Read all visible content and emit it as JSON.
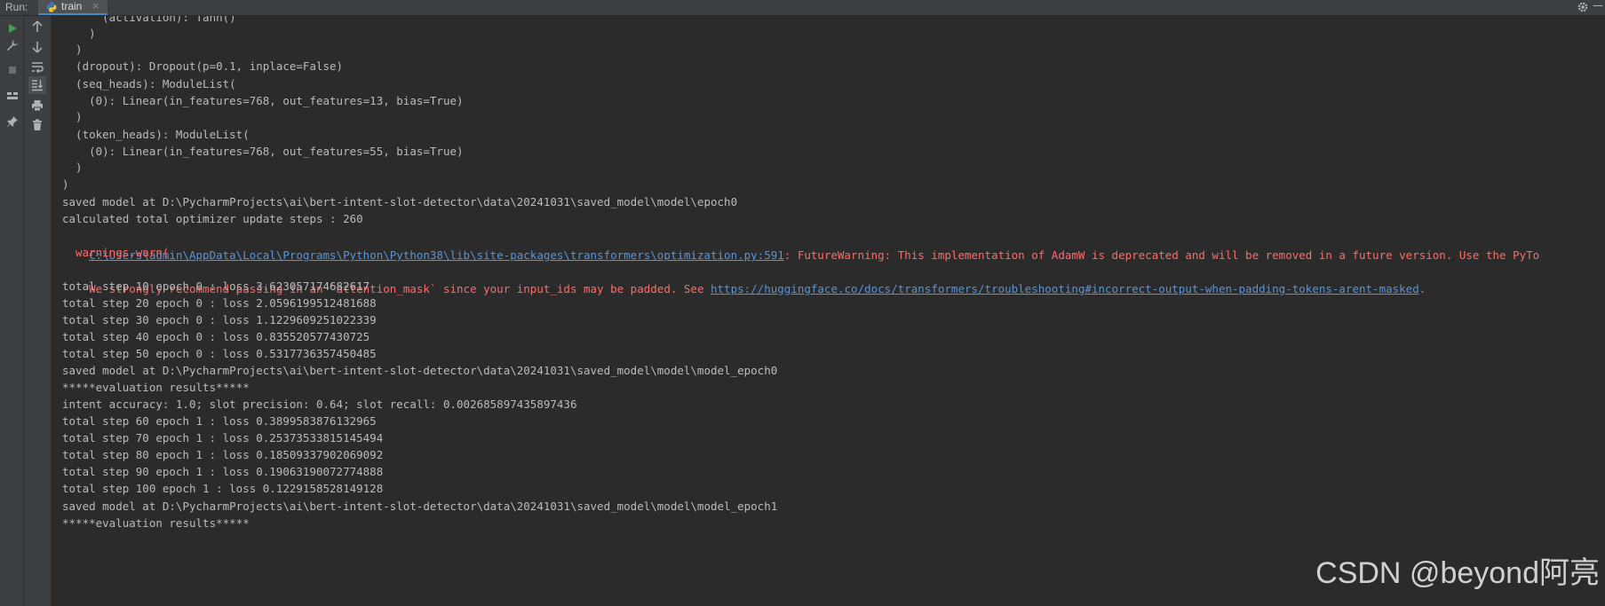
{
  "titlebar": {
    "run_label": "Run:",
    "tab_title": "train",
    "tab_icon": "python-icon",
    "close_glyph": "×",
    "settings_icon": "gear-icon",
    "minimize_glyph": "—"
  },
  "left_toolbar": [
    {
      "name": "rerun-icon",
      "color": "#499c54"
    },
    {
      "name": "wrench-icon",
      "color": "#afb1b3"
    },
    {
      "name": "stop-icon",
      "color": "#6e6e6e"
    },
    {
      "name": "layout-icon",
      "color": "#afb1b3"
    },
    {
      "name": "pin-icon",
      "color": "#afb1b3"
    }
  ],
  "console_toolbar": [
    {
      "name": "arrow-up-icon"
    },
    {
      "name": "arrow-down-icon"
    },
    {
      "name": "soft-wrap-icon"
    },
    {
      "name": "scroll-to-end-icon"
    },
    {
      "name": "print-icon"
    },
    {
      "name": "trash-icon"
    }
  ],
  "colors": {
    "background": "#2b2b2b",
    "toolbar": "#3c3f41",
    "text": "#bbbbbb",
    "error": "#ff6b68",
    "link": "#5894d9",
    "accent": "#4a88c7"
  },
  "console": {
    "lines": [
      "      (activation): Tanh()",
      "    )",
      "  )",
      "  (dropout): Dropout(p=0.1, inplace=False)",
      "  (seq_heads): ModuleList(",
      "    (0): Linear(in_features=768, out_features=13, bias=True)",
      "  )",
      "  (token_heads): ModuleList(",
      "    (0): Linear(in_features=768, out_features=55, bias=True)",
      "  )",
      ")",
      "saved model at D:\\PycharmProjects\\ai\\bert-intent-slot-detector\\data\\20241031\\saved_model\\model\\epoch0",
      "calculated total optimizer update steps : 260"
    ],
    "warning_line": {
      "link": "C:\\Users\\admin\\AppData\\Local\\Programs\\Python\\Python38\\lib\\site-packages\\transformers\\optimization.py:591",
      "text": ": FutureWarning: This implementation of AdamW is deprecated and will be removed in a future version. Use the PyTo"
    },
    "warning_call": "  warnings.warn(",
    "attention_line": {
      "text": "We strongly recommend passing in an `attention_mask` since your input_ids may be padded. See ",
      "link": "https://huggingface.co/docs/transformers/troubleshooting#incorrect-output-when-padding-tokens-arent-masked",
      "suffix": "."
    },
    "lines_after": [
      "total step 10 epoch 0 : loss 3.623057174682617",
      "total step 20 epoch 0 : loss 2.0596199512481688",
      "total step 30 epoch 0 : loss 1.1229609251022339",
      "total step 40 epoch 0 : loss 0.835520577430725",
      "total step 50 epoch 0 : loss 0.5317736357450485",
      "saved model at D:\\PycharmProjects\\ai\\bert-intent-slot-detector\\data\\20241031\\saved_model\\model\\model_epoch0",
      "*****evaluation results*****",
      "intent accuracy: 1.0; slot precision: 0.64; slot recall: 0.002685897435897436",
      "total step 60 epoch 1 : loss 0.3899583876132965",
      "total step 70 epoch 1 : loss 0.25373533815145494",
      "total step 80 epoch 1 : loss 0.18509337902069092",
      "total step 90 epoch 1 : loss 0.19063190072774888",
      "total step 100 epoch 1 : loss 0.1229158528149128",
      "saved model at D:\\PycharmProjects\\ai\\bert-intent-slot-detector\\data\\20241031\\saved_model\\model\\model_epoch1",
      "*****evaluation results*****"
    ]
  },
  "watermark": "CSDN @beyond阿亮"
}
